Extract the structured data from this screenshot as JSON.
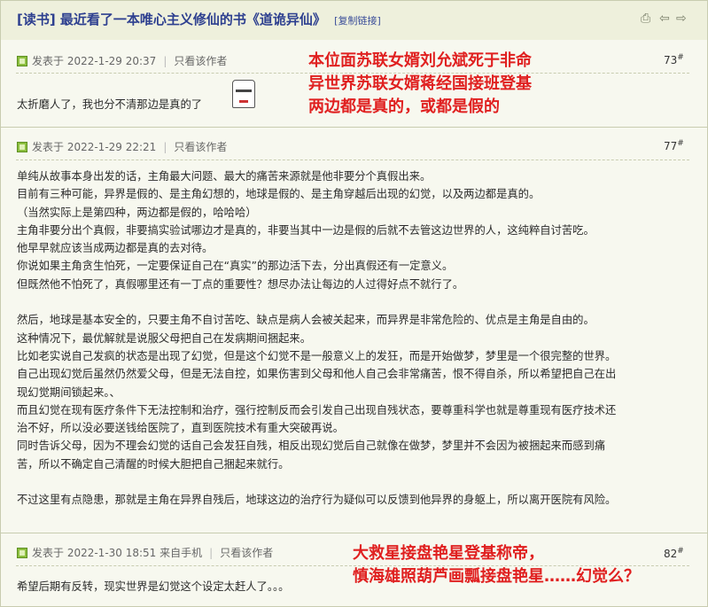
{
  "thread": {
    "title": "[读书] 最近看了一本唯心主义修仙的书《道诡异仙》",
    "copy_link": "[复制链接]",
    "tools": {
      "print": "⎙",
      "prev": "⇦",
      "next": "⇨"
    }
  },
  "posts": [
    {
      "posted": "发表于 2022-1-29 20:37",
      "author_only": "只看该作者",
      "floor_num": "73",
      "floor_mark": "#",
      "lines": [
        "太折磨人了，我也分不清那边是真的了"
      ],
      "emoticon": "confused-face-icon",
      "overlay": [
        "本位面苏联女婿刘允斌死于非命",
        "异世界苏联女婿蒋经国接班登基",
        "两边都是真的，或都是假的"
      ]
    },
    {
      "posted": "发表于 2022-1-29 22:21",
      "author_only": "只看该作者",
      "floor_num": "77",
      "floor_mark": "#",
      "lines": [
        "单纯从故事本身出发的话，主角最大问题、最大的痛苦来源就是他非要分个真假出来。",
        "目前有三种可能，异界是假的、是主角幻想的，地球是假的、是主角穿越后出现的幻觉，以及两边都是真的。",
        "（当然实际上是第四种，两边都是假的，哈哈哈）",
        "主角非要分出个真假，非要搞实验试哪边才是真的，非要当其中一边是假的后就不去管这边世界的人，这纯粹自讨苦吃。",
        "他早早就应该当成两边都是真的去对待。",
        "你说如果主角贪生怕死，一定要保证自己在“真实”的那边活下去，分出真假还有一定意义。",
        "但既然他不怕死了，真假哪里还有一丁点的重要性？想尽办法让每边的人过得好点不就行了。",
        "",
        "然后，地球是基本安全的，只要主角不自讨苦吃、缺点是病人会被关起来，而异界是非常危险的、优点是主角是自由的。",
        "这种情况下，最优解就是说服父母把自己在发病期间捆起来。",
        "比如老实说自己发疯的状态是出现了幻觉，但是这个幻觉不是一般意义上的发狂，而是开始做梦，梦里是一个很完整的世界。",
        "自己出现幻觉后虽然仍然爱父母，但是无法自控，如果伤害到父母和他人自己会非常痛苦，恨不得自杀，所以希望把自己在出",
        "现幻觉期间锁起来。、",
        "而且幻觉在现有医疗条件下无法控制和治疗，强行控制反而会引发自己出现自残状态，要尊重科学也就是尊重现有医疗技术还",
        "治不好，所以没必要送钱给医院了，直到医院技术有重大突破再说。",
        "同时告诉父母，因为不理会幻觉的话自己会发狂自残，相反出现幻觉后自己就像在做梦，梦里并不会因为被捆起来而感到痛",
        "苦，所以不确定自己清醒的时候大胆把自己捆起来就行。",
        "",
        "不过这里有点隐患，那就是主角在异界自残后，地球这边的治疗行为疑似可以反馈到他异界的身躯上，所以离开医院有风险。"
      ]
    },
    {
      "posted": "发表于 2022-1-30 18:51 来自手机",
      "author_only": "只看该作者",
      "floor_num": "82",
      "floor_mark": "#",
      "lines": [
        "希望后期有反转，现实世界是幻觉这个设定太赶人了。。。"
      ],
      "overlay": [
        "大救星接盘艳星登基称帝，",
        "慎海雄照葫芦画瓢接盘艳星……幻觉么？"
      ]
    }
  ]
}
